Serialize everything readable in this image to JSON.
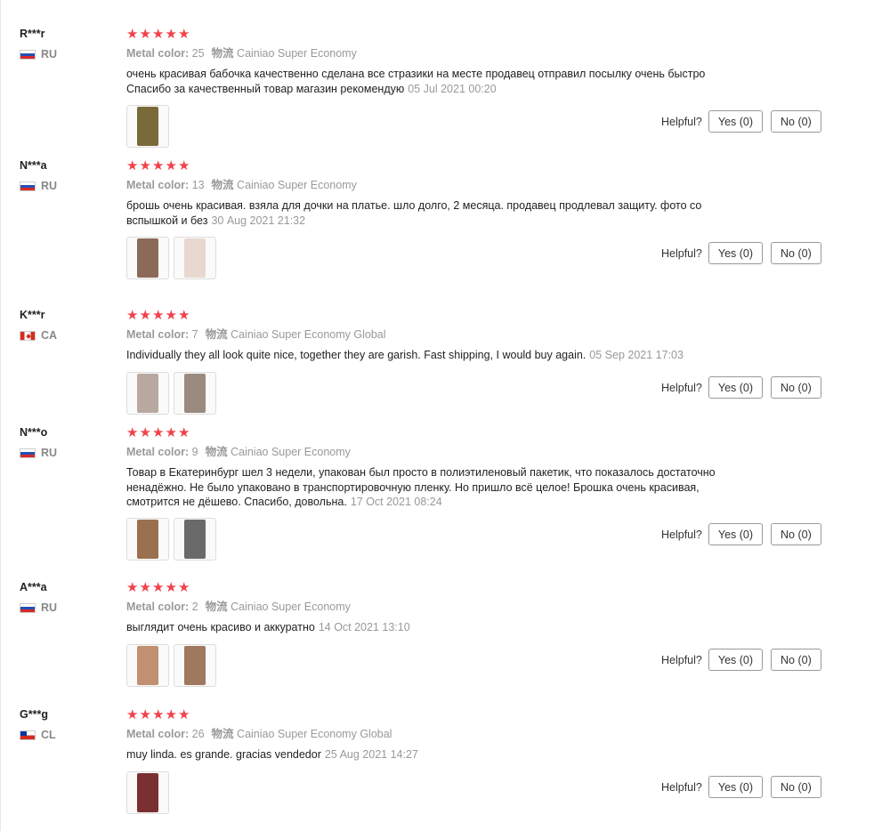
{
  "helpful_label": "Helpful?",
  "star_glyph": "★",
  "star_color": "#f0424a",
  "reviews": [
    {
      "user": "R***r",
      "country": "RU",
      "flag": "ru",
      "stars": 5,
      "color_label": "Metal color:",
      "color_value": "25",
      "shipping_label": "物流",
      "shipping_value": "Cainiao Super Economy",
      "text": "очень красивая бабочка качественно сделана все стразики на месте продавец отправил посылку очень быстро Спасибо за качественный товар магазин рекомендую",
      "date": "05 Jul 2021 00:20",
      "photos": 1,
      "yes": "Yes (0)",
      "no": "No (0)"
    },
    {
      "user": "N***a",
      "country": "RU",
      "flag": "ru",
      "stars": 5,
      "color_label": "Metal color:",
      "color_value": "13",
      "shipping_label": "物流",
      "shipping_value": "Cainiao Super Economy",
      "text": "брошь очень красивая. взяла для дочки на платье. шло долго, 2 месяца. продавец продлевал защиту. фото со вспышкой и без",
      "date": "30 Aug 2021 21:32",
      "photos": 2,
      "yes": "Yes (0)",
      "no": "No (0)"
    },
    {
      "user": "K***r",
      "country": "CA",
      "flag": "ca",
      "stars": 5,
      "color_label": "Metal color:",
      "color_value": "7",
      "shipping_label": "物流",
      "shipping_value": "Cainiao Super Economy Global",
      "text": "Individually they all look quite nice, together they are garish. Fast shipping, I would buy again.",
      "date": "05 Sep 2021 17:03",
      "photos": 2,
      "yes": "Yes (0)",
      "no": "No (0)"
    },
    {
      "user": "N***o",
      "country": "RU",
      "flag": "ru",
      "stars": 5,
      "color_label": "Metal color:",
      "color_value": "9",
      "shipping_label": "物流",
      "shipping_value": "Cainiao Super Economy",
      "text": "Товар в Екатеринбург шел 3 недели, упакован был просто в полиэтиленовый пакетик, что показалось достаточно ненадёжно. Не было упаковано в транспортировочную пленку. Но пришло всё целое! Брошка очень красивая, смотрится не дёшево. Спасибо, довольна.",
      "date": "17 Oct 2021 08:24",
      "photos": 2,
      "yes": "Yes (0)",
      "no": "No (0)"
    },
    {
      "user": "A***a",
      "country": "RU",
      "flag": "ru",
      "stars": 5,
      "color_label": "Metal color:",
      "color_value": "2",
      "shipping_label": "物流",
      "shipping_value": "Cainiao Super Economy",
      "text": "выглядит очень красиво и аккуратно",
      "date": "14 Oct 2021 13:10",
      "photos": 2,
      "yes": "Yes (0)",
      "no": "No (0)"
    },
    {
      "user": "G***g",
      "country": "CL",
      "flag": "cl",
      "stars": 5,
      "color_label": "Metal color:",
      "color_value": "26",
      "shipping_label": "物流",
      "shipping_value": "Cainiao Super Economy Global",
      "text": "muy linda. es grande. gracias vendedor",
      "date": "25 Aug 2021 14:27",
      "photos": 1,
      "yes": "Yes (0)",
      "no": "No (0)"
    }
  ]
}
